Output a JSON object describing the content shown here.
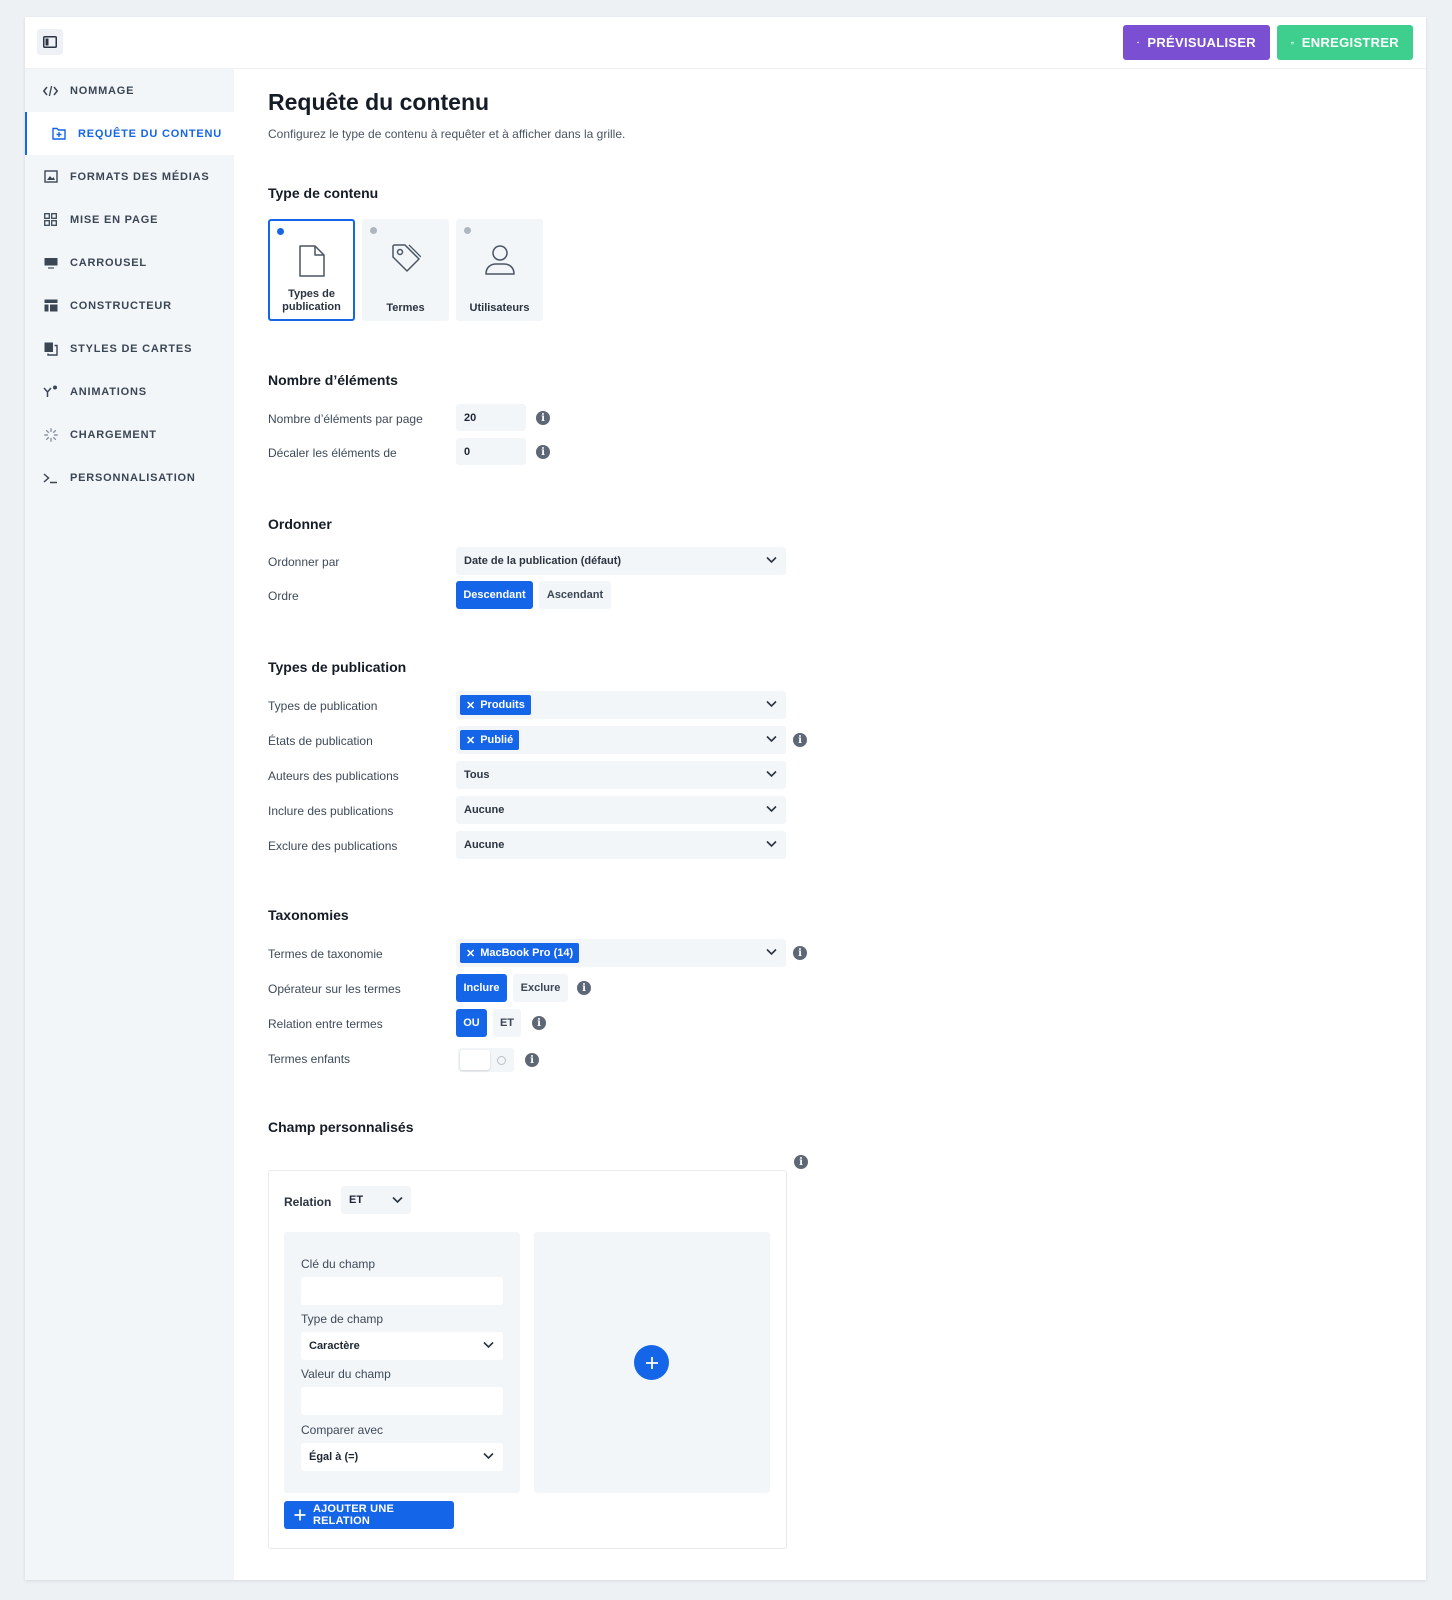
{
  "header": {
    "preview_label": "PRÉVISUALISER",
    "save_label": "ENREGISTRER",
    "preview_color": "#7b4fd1",
    "save_color": "#3ecf8e"
  },
  "sidebar": {
    "items": [
      {
        "label": "NOMMAGE",
        "icon": "code-icon"
      },
      {
        "label": "REQUÊTE DU CONTENU",
        "icon": "query-icon",
        "active": true
      },
      {
        "label": "FORMATS DES MÉDIAS",
        "icon": "image-icon"
      },
      {
        "label": "MISE EN PAGE",
        "icon": "grid-icon"
      },
      {
        "label": "CARROUSEL",
        "icon": "carousel-icon"
      },
      {
        "label": "CONSTRUCTEUR",
        "icon": "builder-icon"
      },
      {
        "label": "STYLES DE CARTES",
        "icon": "cards-icon"
      },
      {
        "label": "ANIMATIONS",
        "icon": "animation-icon"
      },
      {
        "label": "CHARGEMENT",
        "icon": "spinner-icon"
      },
      {
        "label": "PERSONNALISATION",
        "icon": "terminal-icon"
      }
    ]
  },
  "page": {
    "title": "Requête du contenu",
    "subtitle": "Configurez le type de contenu à requêter et à afficher dans la grille."
  },
  "content_type": {
    "heading": "Type de contenu",
    "options": [
      {
        "label": "Types de publication",
        "icon": "document-icon",
        "selected": true
      },
      {
        "label": "Termes",
        "icon": "tag-icon",
        "selected": false
      },
      {
        "label": "Utilisateurs",
        "icon": "user-icon",
        "selected": false
      }
    ]
  },
  "item_count": {
    "heading": "Nombre d’éléments",
    "per_page_label": "Nombre d’éléments par page",
    "per_page_value": "20",
    "offset_label": "Décaler les éléments de",
    "offset_value": "0"
  },
  "order": {
    "heading": "Ordonner",
    "order_by_label": "Ordonner par",
    "order_by_value": "Date de la publication (défaut)",
    "order_label": "Ordre",
    "descending": "Descendant",
    "ascending": "Ascendant"
  },
  "post_types": {
    "heading": "Types de publication",
    "types_label": "Types de publication",
    "types_tag": "Produits",
    "status_label": "États de publication",
    "status_tag": "Publié",
    "authors_label": "Auteurs des publications",
    "authors_value": "Tous",
    "include_label": "Inclure des publications",
    "include_value": "Aucune",
    "exclude_label": "Exclure des publications",
    "exclude_value": "Aucune"
  },
  "taxonomies": {
    "heading": "Taxonomies",
    "terms_label": "Termes de taxonomie",
    "terms_tag": "MacBook Pro (14)",
    "operator_label": "Opérateur sur les termes",
    "include": "Inclure",
    "exclude": "Exclure",
    "relation_label": "Relation entre termes",
    "or": "OU",
    "and": "ET",
    "children_label": "Termes enfants"
  },
  "custom_fields": {
    "heading": "Champ personnalisés",
    "relation_label": "Relation",
    "relation_value": "ET",
    "key_label": "Clé du champ",
    "key_value": "",
    "type_label": "Type de champ",
    "type_value": "Caractère",
    "value_label": "Valeur du champ",
    "value_value": "",
    "compare_label": "Comparer avec",
    "compare_value": "Égal à (=)",
    "add_relation": "AJOUTER UNE RELATION"
  }
}
